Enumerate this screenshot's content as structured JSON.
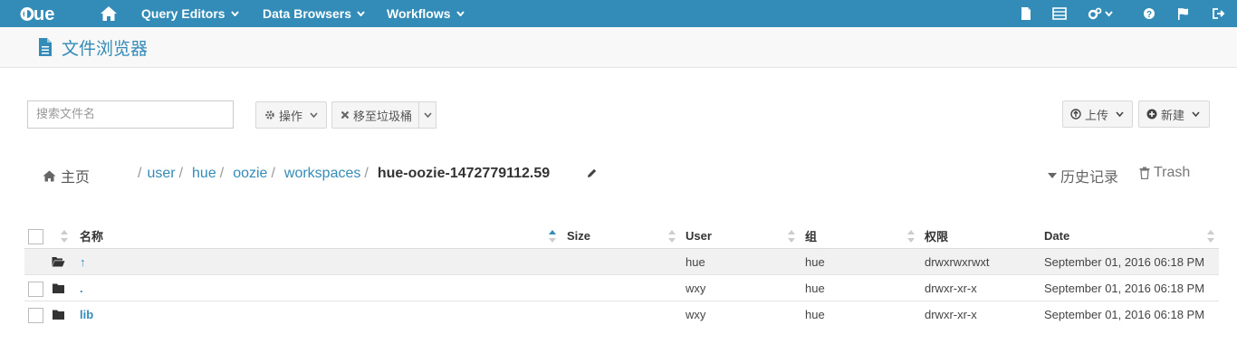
{
  "navbar": {
    "brand": "HUE",
    "menus": [
      "Query Editors",
      "Data Browsers",
      "Workflows"
    ],
    "right_icons": [
      "document-icon",
      "table-icon",
      "cogs-icon",
      "help-icon",
      "flag-icon",
      "logout-icon"
    ],
    "bg_color": "#338bb8"
  },
  "page": {
    "title": "文件浏览器"
  },
  "toolbar": {
    "search_placeholder": "搜索文件名",
    "actions_label": "操作",
    "trash_label": "移至垃圾桶",
    "upload_label": "上传",
    "new_label": "新建"
  },
  "breadcrumb": {
    "home_label": "主页",
    "parts": [
      "user",
      "hue",
      "oozie",
      "workspaces"
    ],
    "current": "hue-oozie-1472779112.59",
    "history_label": "历史记录",
    "trash_label": "Trash"
  },
  "table": {
    "columns": [
      "名称",
      "Size",
      "User",
      "组",
      "权限",
      "Date"
    ],
    "rows": [
      {
        "name": "↑",
        "size": "",
        "user": "hue",
        "group": "hue",
        "perm": "drwxrwxrwxt",
        "date": "September 01, 2016 06:18 PM"
      },
      {
        "name": ".",
        "size": "",
        "user": "wxy",
        "group": "hue",
        "perm": "drwxr-xr-x",
        "date": "September 01, 2016 06:18 PM"
      },
      {
        "name": "lib",
        "size": "",
        "user": "wxy",
        "group": "hue",
        "perm": "drwxr-xr-x",
        "date": "September 01, 2016 06:18 PM"
      }
    ]
  }
}
